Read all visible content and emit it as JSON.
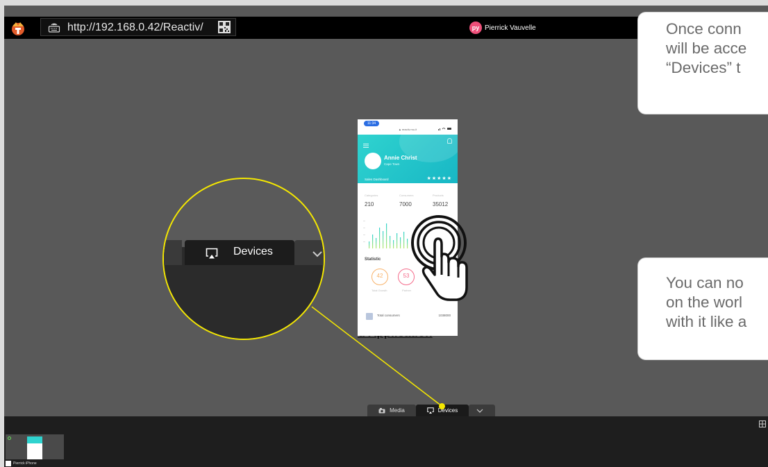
{
  "topbar": {
    "url": "http://192.168.0.42/Reactiv/",
    "user_initials": "py",
    "user_name": "Pierrick Vauvelle"
  },
  "callouts": {
    "connect_lines": [
      "Once conn",
      "will be acce",
      "“Devices” t"
    ],
    "interact_lines": [
      "You can no",
      "on the worl",
      "with it like a"
    ]
  },
  "phone": {
    "time": "11:34",
    "mini_url": "▲ reactiv.mu.it",
    "profile_name": "Annie Christ",
    "profile_city": "Cape Town",
    "dashboard_label": "Sales Dashboard",
    "rating_stars": "★★★★★",
    "stats": [
      {
        "label": "Categories",
        "value": "210"
      },
      {
        "label": "Consumers",
        "value": "7000"
      },
      {
        "label": "Products",
        "value": "35012"
      }
    ],
    "statistic_title": "Statistic",
    "rings": [
      {
        "value": "42",
        "label": "Total Growth",
        "color": "#f8b26a"
      },
      {
        "value": "53",
        "label": "Partner",
        "color": "#f56a8a"
      }
    ],
    "list_item_label": "Total consumers",
    "list_item_value": "1038000",
    "accent_color": "#2fd3cf"
  },
  "behind_text": "rd Application",
  "zoom_view": {
    "devices_label": "Devices"
  },
  "bottom_tabs": {
    "media_label": "Media",
    "devices_label": "Devices"
  },
  "device_thumb": {
    "label": "Pierrick iPhone"
  },
  "colors": {
    "pointer": "#f5e800",
    "background": "#595959",
    "topbar": "#000000"
  }
}
